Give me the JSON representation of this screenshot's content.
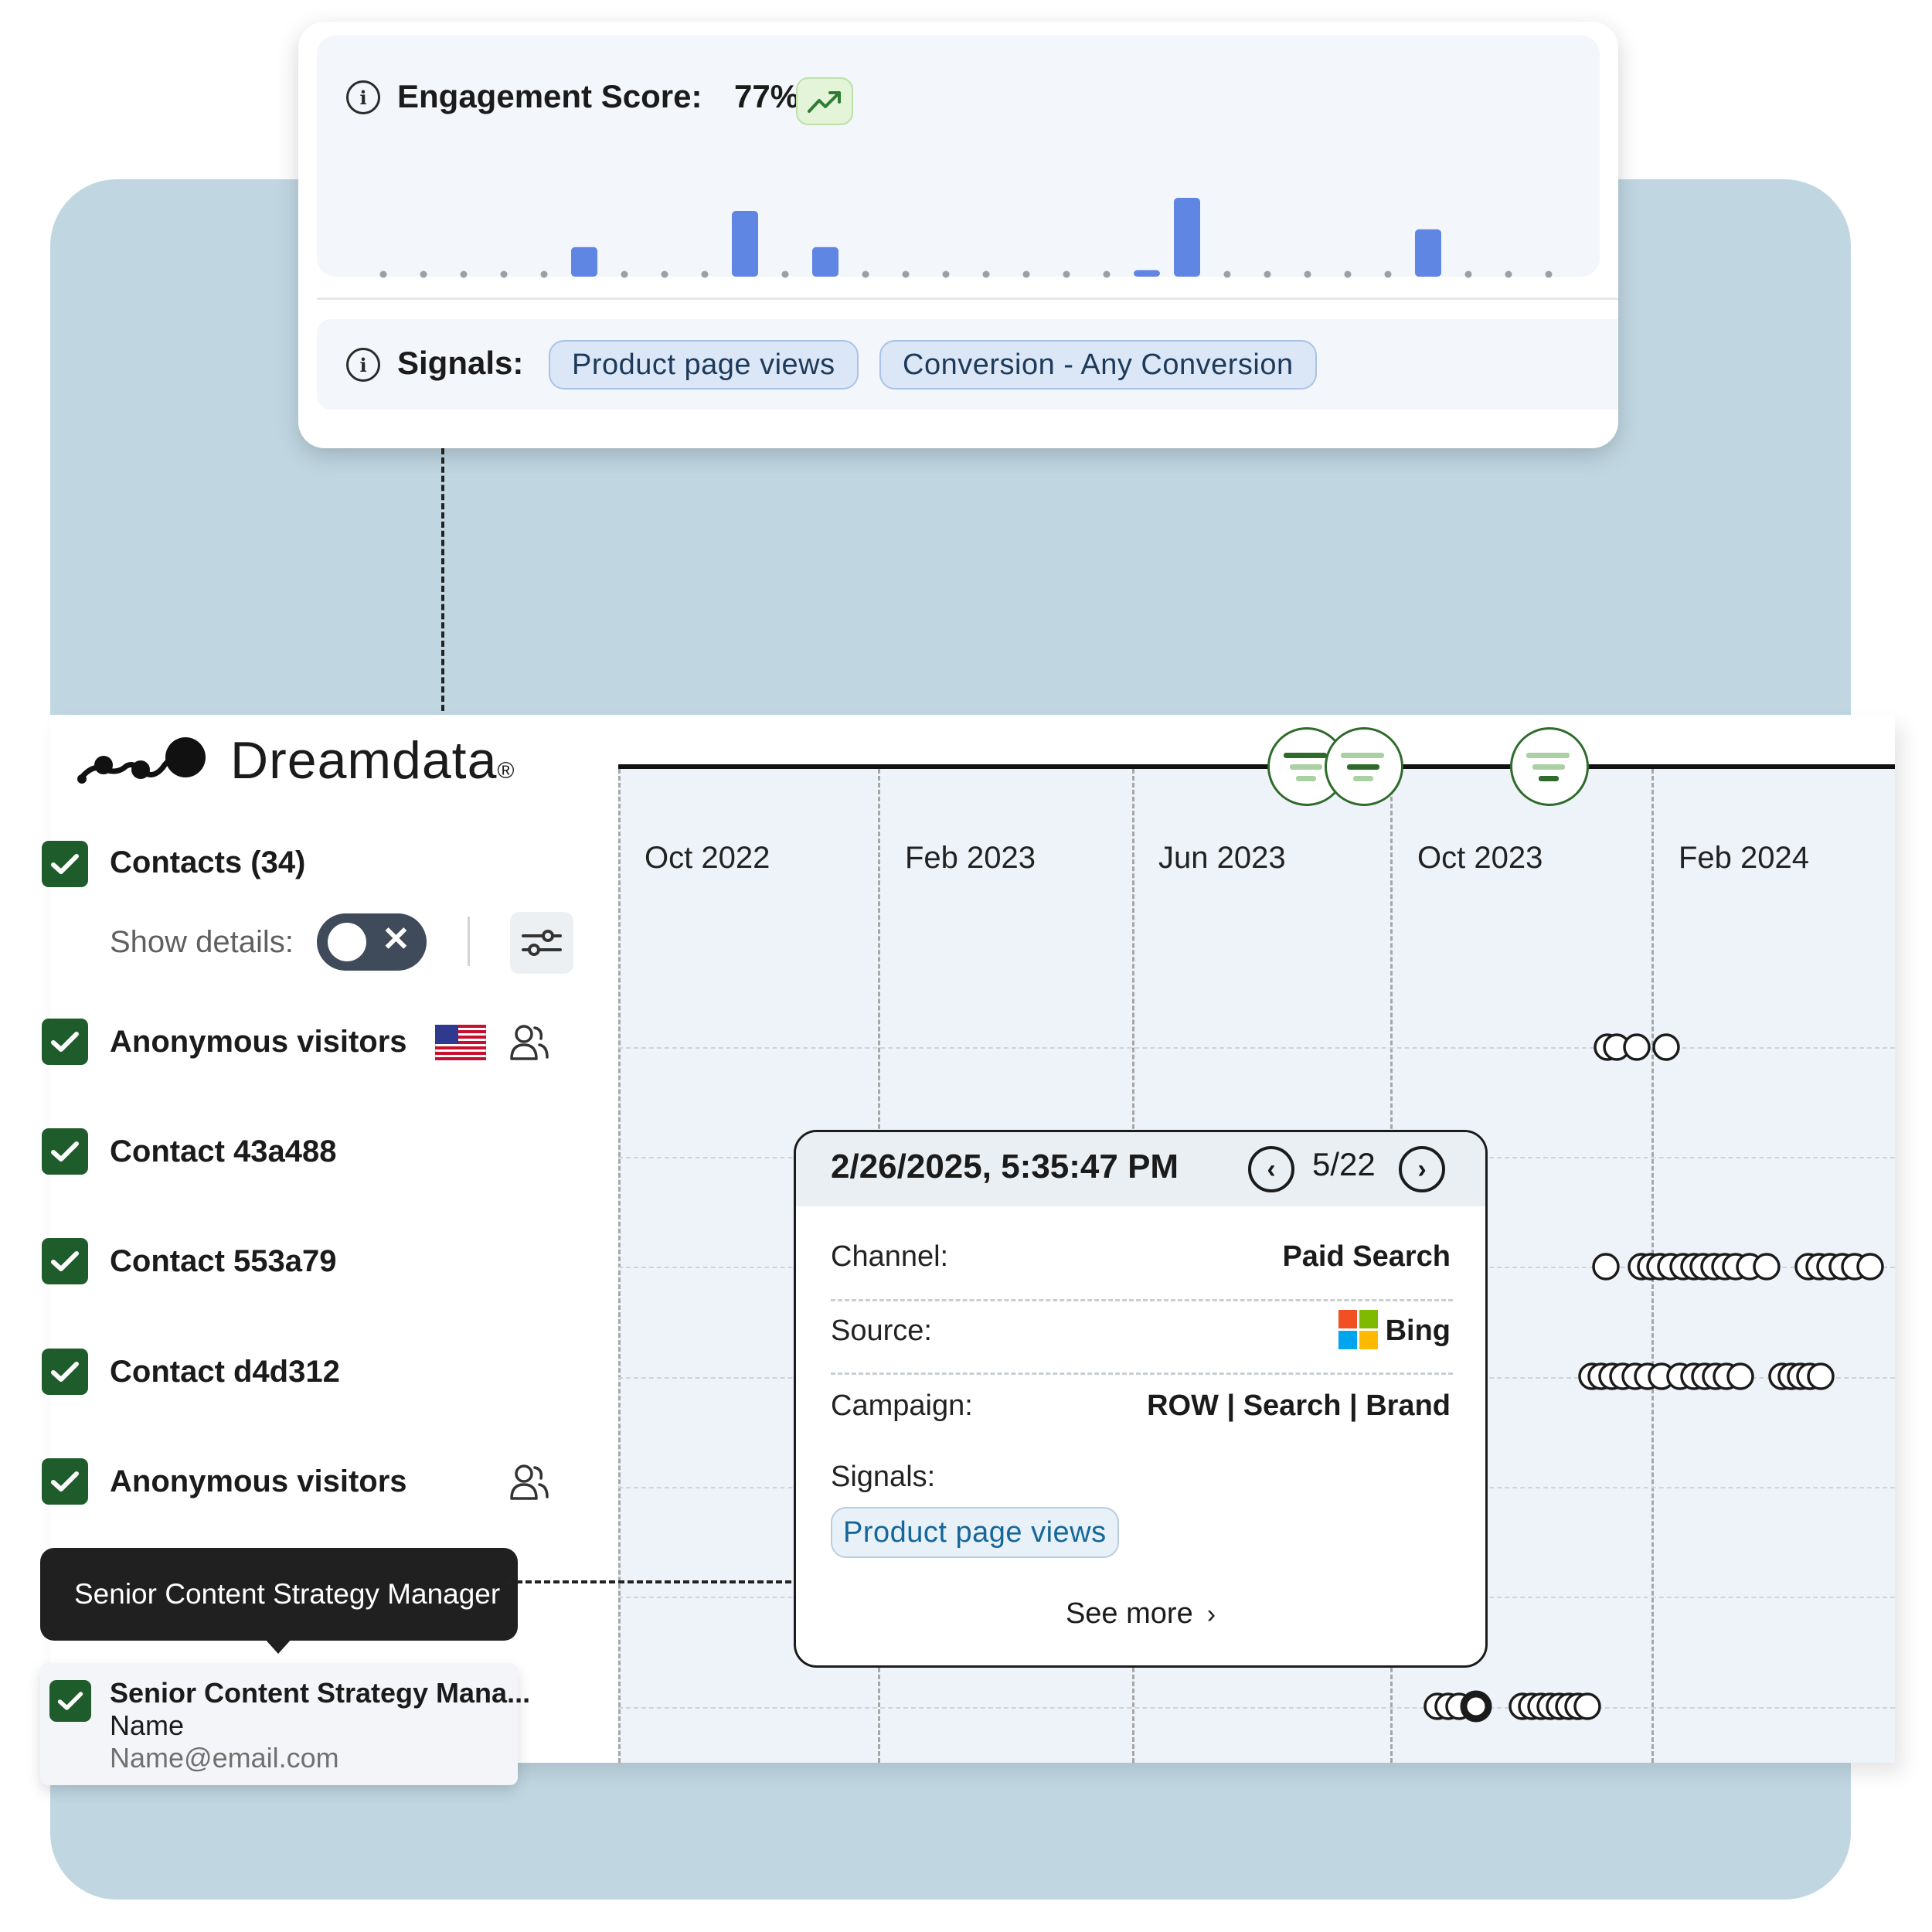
{
  "engagement": {
    "label": "Engagement Score:",
    "score": "77%",
    "trend_icon": "trending-up-icon",
    "sparkline": [
      0,
      0,
      0,
      0,
      0,
      0.45,
      0,
      0,
      0,
      1.0,
      0,
      0.45,
      0,
      0,
      0,
      0,
      0,
      0,
      0,
      0.1,
      1.2,
      0,
      0,
      0,
      0,
      0,
      0.72,
      0,
      0,
      0
    ],
    "signals_label": "Signals:",
    "signals": [
      "Product page views",
      "Conversion - Any Conversion"
    ]
  },
  "brand": {
    "name": "Dreamdata",
    "registered": "®"
  },
  "sidebar": {
    "contacts_label": "Contacts (34)",
    "show_details_label": "Show details:",
    "rows": [
      {
        "label": "Anonymous visitors",
        "flag": true,
        "people_icon": true
      },
      {
        "label": "Contact 43a488",
        "flag": false,
        "people_icon": false
      },
      {
        "label": "Contact 553a79",
        "flag": false,
        "people_icon": false
      },
      {
        "label": "Contact d4d312",
        "flag": false,
        "people_icon": false
      },
      {
        "label": "Anonymous visitors",
        "flag": false,
        "people_icon": true
      }
    ],
    "tooltip": "Senior Content Strategy Manager",
    "contact_card": {
      "title": "Senior Content Strategy Mana...",
      "name": "Name",
      "email": "Name@email.com"
    }
  },
  "timeline": {
    "months": [
      "Oct 2022",
      "Feb 2023",
      "Jun 2023",
      "Oct 2023",
      "Feb 2024"
    ]
  },
  "popup": {
    "datetime": "2/26/2025, 5:35:47 PM",
    "pager": "5/22",
    "channel_label": "Channel:",
    "channel_value": "Paid Search",
    "source_label": "Source:",
    "source_value": "Bing",
    "campaign_label": "Campaign:",
    "campaign_value": "ROW | Search | Brand",
    "signals_label": "Signals:",
    "signal_chip": "Product page views",
    "see_more": "See more"
  },
  "colors": {
    "background_panel": "#c0d7e2",
    "checkbox": "#1f5c2b",
    "bar": "#5f86e3",
    "chip_border": "#a9c3e6",
    "trend": "#2e7d32"
  }
}
